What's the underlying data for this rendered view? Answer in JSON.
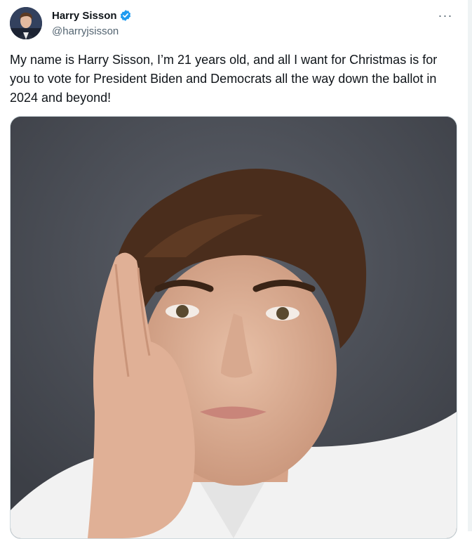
{
  "author": {
    "display_name": "Harry Sisson",
    "handle": "@harryjsisson",
    "verified": true,
    "verified_icon": "verified-badge-icon",
    "avatar_icon": "avatar"
  },
  "menu": {
    "more_label": "···",
    "more_icon": "more-dots-icon"
  },
  "tweet": {
    "text": "My name is Harry Sisson, I’m 21 years old, and all I want for Christmas is for you to vote for President Biden and Democrats all the way down the ballot in 2024 and beyond!"
  },
  "media": {
    "type": "photo",
    "subject": "portrait-photo"
  },
  "colors": {
    "verified_blue": "#1d9bf0",
    "text_primary": "#0f1419",
    "text_secondary": "#536471",
    "photo_background": "#4a4d55"
  }
}
